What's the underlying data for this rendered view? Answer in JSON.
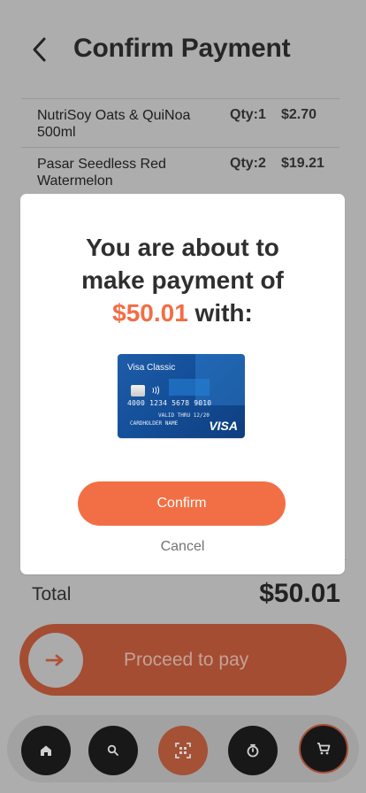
{
  "header": {
    "title": "Confirm Payment",
    "back_icon": "chevron-left-icon"
  },
  "order": {
    "items": [
      {
        "name": "NutriSoy Oats & QuiNoa 500ml",
        "qty": "Qty:1",
        "price": "$2.70"
      },
      {
        "name": "Pasar Seedless Red Watermelon",
        "qty": "Qty:2",
        "price": "$19.21"
      }
    ],
    "total_label": "Total",
    "total_value": "$50.01"
  },
  "modal": {
    "title_line1": "You are about to",
    "title_line2": "make payment of",
    "amount": "$50.01",
    "title_line3_suffix": " with:",
    "confirm_label": "Confirm",
    "cancel_label": "Cancel",
    "card": {
      "brand": "Visa Classic",
      "number": "4000 1234 5678 9010",
      "expiry_prefix": "VALID THRU",
      "expiry": "12/20",
      "holder": "CARDHOLDER NAME",
      "network": "VISA"
    }
  },
  "slider": {
    "label": "Proceed to pay",
    "knob_icon": "arrow-right-icon"
  },
  "nav": {
    "items": [
      {
        "name": "home",
        "icon": "home-icon"
      },
      {
        "name": "search",
        "icon": "search-icon"
      },
      {
        "name": "scan",
        "icon": "scan-icon"
      },
      {
        "name": "timer",
        "icon": "timer-icon"
      },
      {
        "name": "cart",
        "icon": "cart-icon"
      }
    ]
  },
  "colors": {
    "accent": "#F26F45",
    "overlay": "#000000",
    "text": "#2F2F2F"
  }
}
